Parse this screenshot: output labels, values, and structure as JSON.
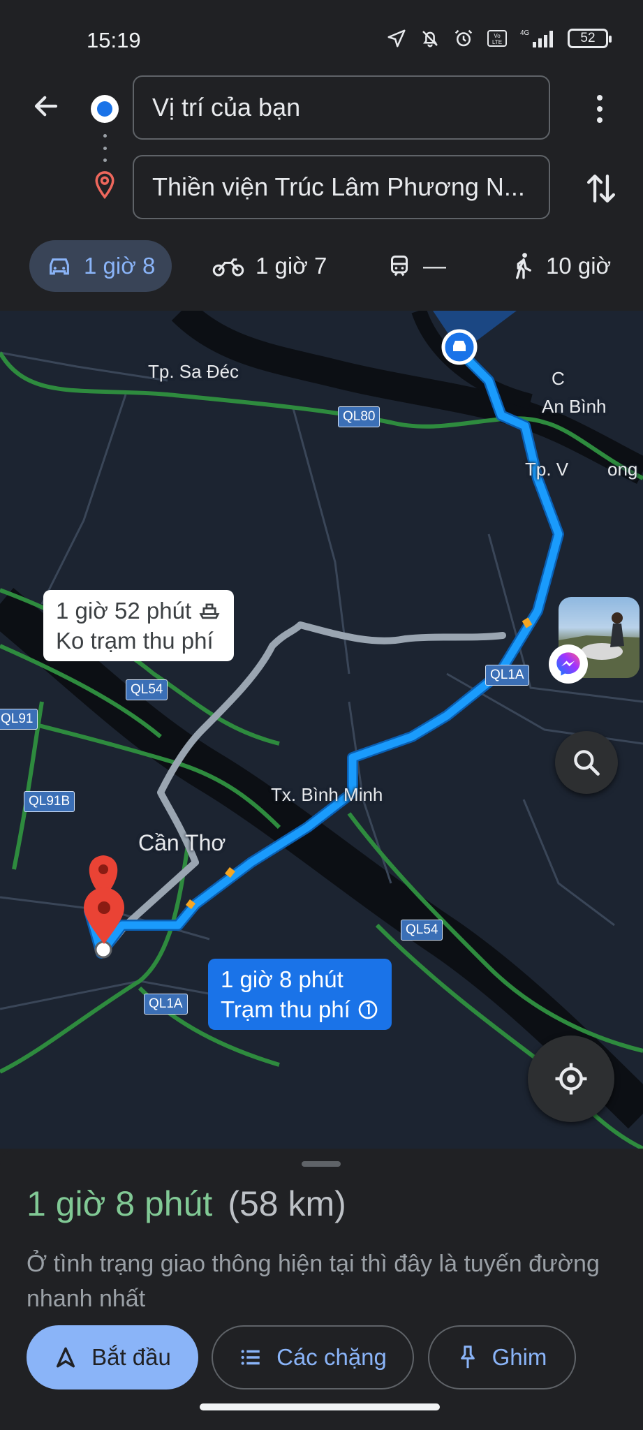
{
  "status_bar": {
    "time": "15:19",
    "network": "4G",
    "volte": "Vo LTE",
    "battery": "52"
  },
  "directions": {
    "origin": "Vị trí của bạn",
    "destination": "Thiền viện Trúc Lâm Phương N..."
  },
  "modes": [
    {
      "label": "1 giờ 8",
      "icon": "car-icon",
      "active": true
    },
    {
      "label": "1 giờ 7",
      "icon": "motorbike-icon",
      "active": false
    },
    {
      "label": "—",
      "icon": "train-icon",
      "active": false
    },
    {
      "label": "10 giờ",
      "icon": "walk-icon",
      "active": false
    }
  ],
  "map": {
    "places": {
      "sa_dec": "Tp. Sa Đéc",
      "an_binh": "An Bình",
      "vinh_long": "Tp. V",
      "vinh_long_tail": "ong",
      "binh_minh": "Tx. Bình Minh",
      "can_tho": "Cần Thơ",
      "c_partial": "C"
    },
    "roads": {
      "ql80": "QL80",
      "ql1a_top": "QL1A",
      "ql54_left": "QL54",
      "ql91": "QL91",
      "ql91b": "QL91B",
      "ql54_right": "QL54",
      "ql1a_bottom": "QL1A"
    },
    "alt_route": {
      "line1": "1 giờ 52 phút",
      "line2": "Ko trạm thu phí"
    },
    "main_route": {
      "line1": "1 giờ 8 phút",
      "line2": "Trạm thu phí"
    },
    "colors": {
      "route_main": "#1a9bfc",
      "route_alt": "#9aa5b1",
      "roads_green": "#2e8b3e",
      "water": "#0c0f14"
    }
  },
  "summary": {
    "duration": "1 giờ 8 phút",
    "distance": "(58 km)",
    "note": "Ở tình trạng giao thông hiện tại thì đây là tuyến đường nhanh nhất",
    "colors": {
      "duration": "#81c995"
    }
  },
  "actions": {
    "start": "Bắt đầu",
    "steps": "Các chặng",
    "pin": "Ghim"
  }
}
